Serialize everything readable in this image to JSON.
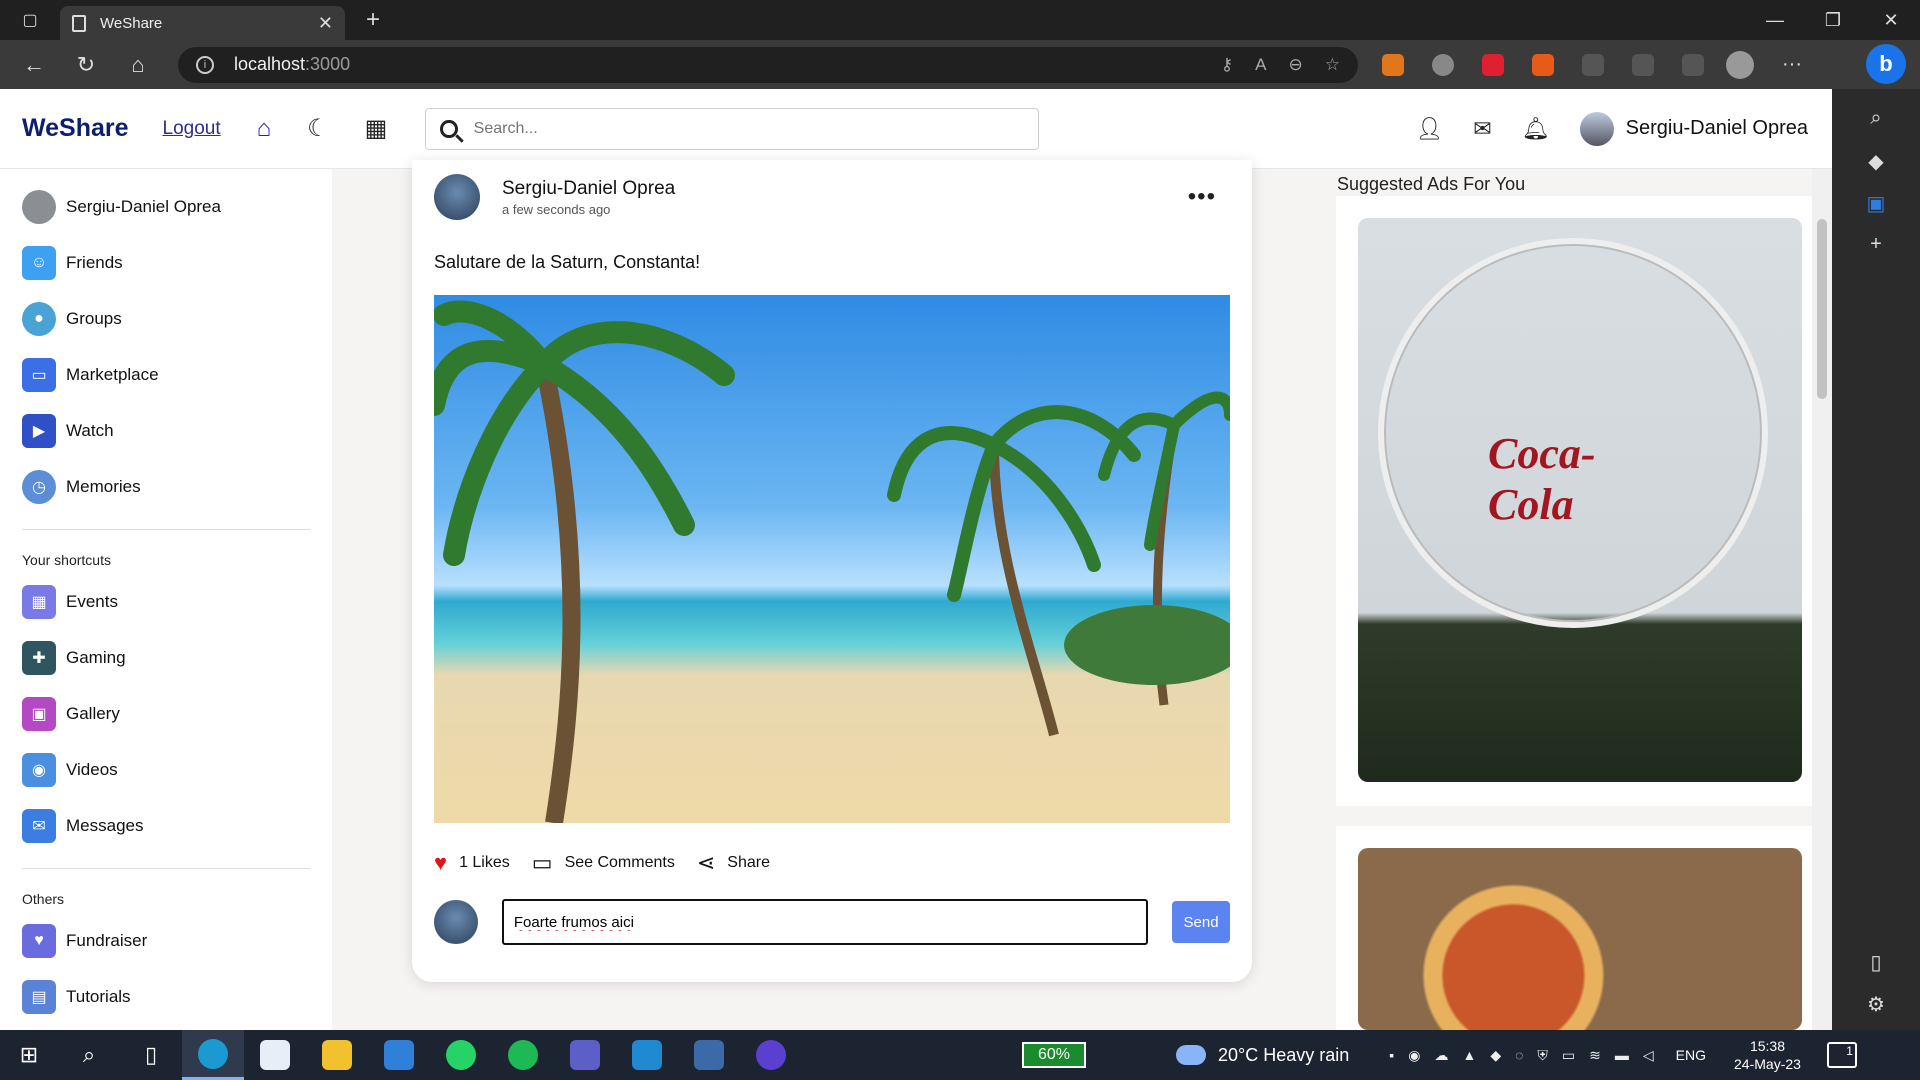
{
  "browser": {
    "tab_title": "WeShare",
    "url_host": "localhost",
    "url_port": ":3000"
  },
  "header": {
    "logo": "WeShare",
    "logout": "Logout",
    "search_placeholder": "Search...",
    "user_name": "Sergiu-Daniel Oprea"
  },
  "sidebar": {
    "items": [
      {
        "label": "Sergiu-Daniel Oprea",
        "icon": "user-avatar-icon",
        "color": "#8b8f94"
      },
      {
        "label": "Friends",
        "icon": "friends-icon",
        "color": "#3ea0f0"
      },
      {
        "label": "Groups",
        "icon": "groups-icon",
        "color": "#49a3d6"
      },
      {
        "label": "Marketplace",
        "icon": "marketplace-icon",
        "color": "#3b6fe6"
      },
      {
        "label": "Watch",
        "icon": "watch-icon",
        "color": "#3050c8"
      },
      {
        "label": "Memories",
        "icon": "memories-icon",
        "color": "#5b8ed6"
      }
    ],
    "shortcuts_title": "Your shortcuts",
    "shortcuts": [
      {
        "label": "Events",
        "icon": "events-icon",
        "color": "#7a7ae6"
      },
      {
        "label": "Gaming",
        "icon": "gaming-icon",
        "color": "#2f5660"
      },
      {
        "label": "Gallery",
        "icon": "gallery-icon",
        "color": "#b34ac3"
      },
      {
        "label": "Videos",
        "icon": "videos-icon",
        "color": "#4a8fe0"
      },
      {
        "label": "Messages",
        "icon": "messages-icon",
        "color": "#3b7de0"
      }
    ],
    "others_title": "Others",
    "others": [
      {
        "label": "Fundraiser",
        "icon": "fundraiser-icon",
        "color": "#6b6be0"
      },
      {
        "label": "Tutorials",
        "icon": "tutorials-icon",
        "color": "#5a82d6"
      }
    ]
  },
  "post": {
    "author": "Sergiu-Daniel Oprea",
    "time": "a few seconds ago",
    "text": "Salutare de la Saturn, Constanta!",
    "likes": "1 Likes",
    "comments": "See Comments",
    "share": "Share",
    "comment_value": "Foarte frumos aici",
    "send": "Send"
  },
  "ads": {
    "title": "Suggested Ads For You",
    "ad1_brand": "Coca-Cola"
  },
  "taskbar": {
    "battery": "60%",
    "weather": "20°C  Heavy rain",
    "lang": "ENG",
    "time": "15:38",
    "date": "24-May-23",
    "notifications": "1"
  }
}
